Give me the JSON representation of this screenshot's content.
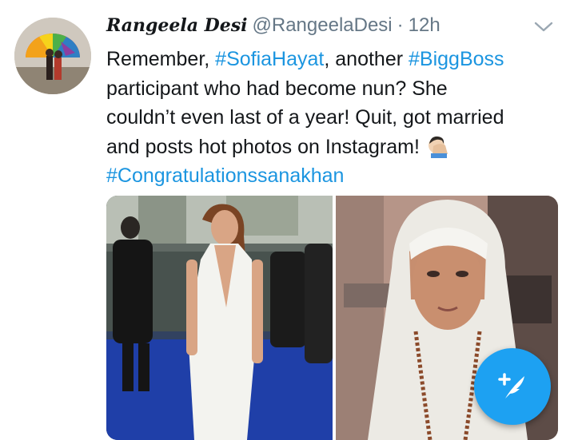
{
  "author": {
    "display_name": "Rangeela Desi",
    "handle": "@RangeelaDesi",
    "separator": "·",
    "time": "12h"
  },
  "tweet": {
    "line1_pre": "Remember, ",
    "hashtag1": "#SofiaHayat",
    "line1_mid": ", another ",
    "hashtag2": "#BiggBoss",
    "line2": "participant who had become nun? She",
    "line3": "couldn’t even last of a year! Quit, got married",
    "line4": "and posts hot photos on Instagram!",
    "emoji": "facepalm-emoji",
    "hashtag3": "#Congratulationssanakhan"
  },
  "icons": {
    "caret": "chevron-down-icon",
    "compose": "compose-tweet-icon"
  },
  "colors": {
    "link": "#1b95e0",
    "muted": "#657786",
    "fab": "#1da1f2"
  }
}
